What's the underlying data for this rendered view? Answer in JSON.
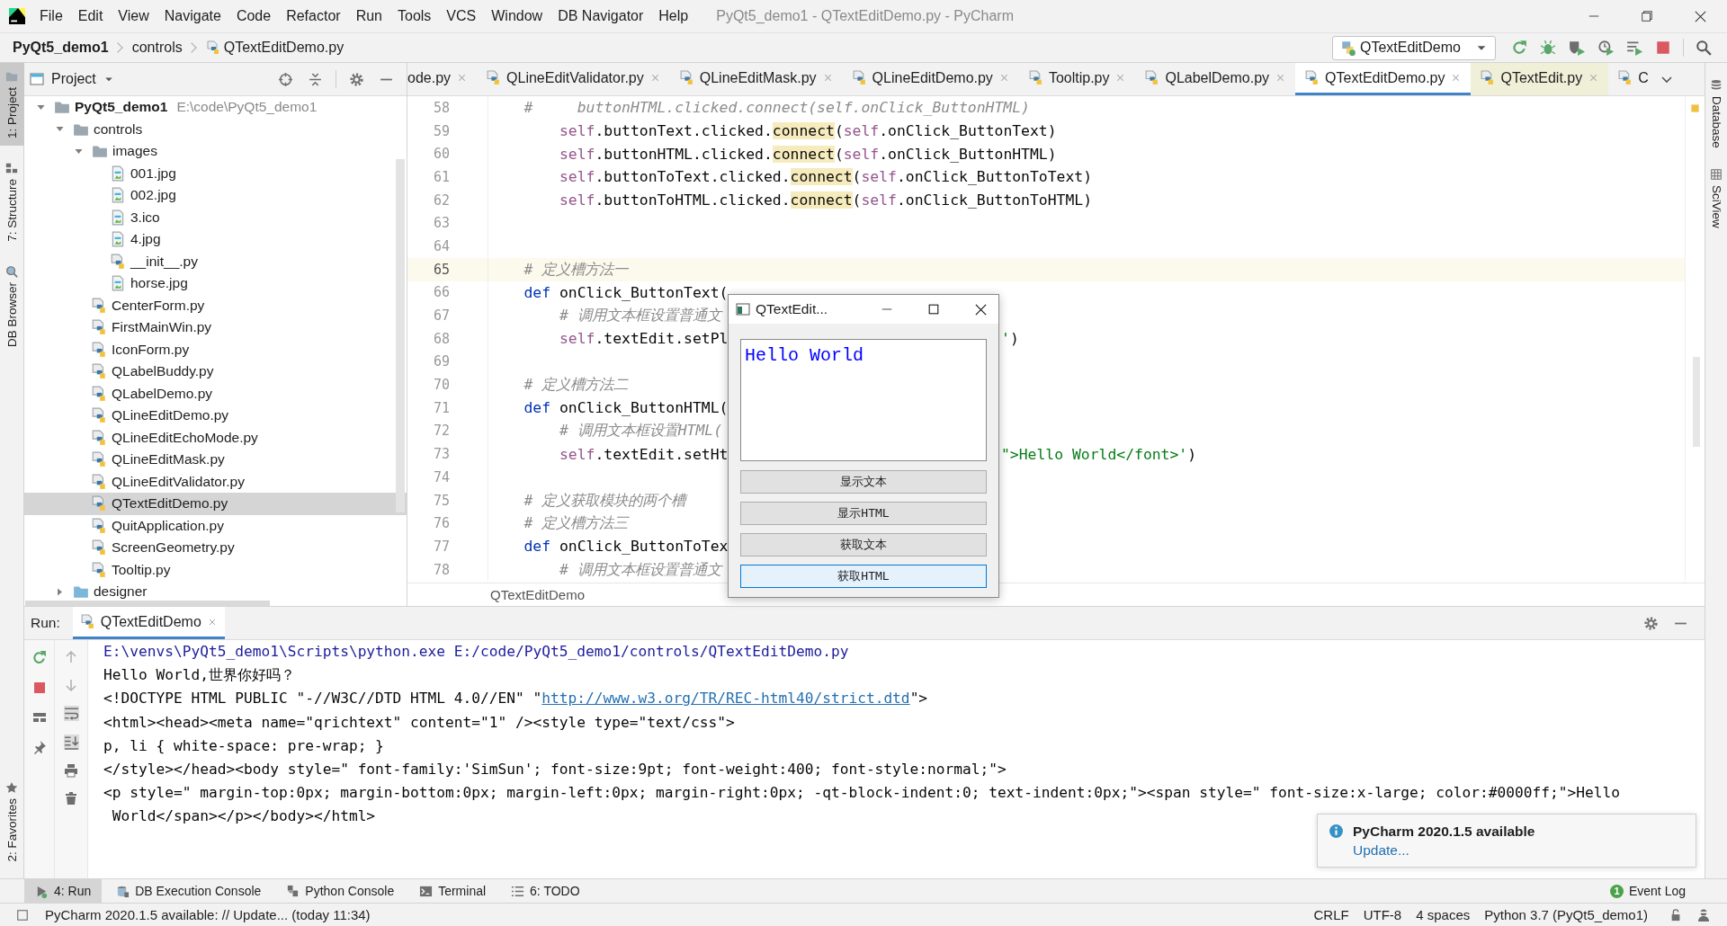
{
  "window": {
    "title": "PyQt5_demo1 - QTextEditDemo.py - PyCharm"
  },
  "menu": [
    "File",
    "Edit",
    "View",
    "Navigate",
    "Code",
    "Refactor",
    "Run",
    "Tools",
    "VCS",
    "Window",
    "DB Navigator",
    "Help"
  ],
  "nav": {
    "crumbs": [
      {
        "label": "PyQt5_demo1",
        "kind": "project"
      },
      {
        "label": "controls",
        "kind": "folder"
      },
      {
        "label": "QTextEditDemo.py",
        "kind": "file"
      }
    ],
    "run_config": "QTextEditDemo"
  },
  "left_strip": [
    {
      "label": "1: Project",
      "kind": "project",
      "selected": true
    },
    {
      "label": "7: Structure",
      "kind": "structure",
      "selected": false
    },
    {
      "label": "DB Browser",
      "kind": "db",
      "selected": false
    },
    {
      "label": "2: Favorites",
      "kind": "favorites",
      "selected": false
    }
  ],
  "right_strip": [
    {
      "label": "Database",
      "kind": "database"
    },
    {
      "label": "SciView",
      "kind": "sciview"
    }
  ],
  "project": {
    "title": "Project",
    "tree": [
      {
        "label": "PyQt5_demo1",
        "path": "E:\\code\\PyQt5_demo1",
        "kind": "folder",
        "expanded": true,
        "selected": false,
        "children": [
          {
            "label": "controls",
            "kind": "folder",
            "expanded": true,
            "selected": false,
            "children": [
              {
                "label": "images",
                "kind": "folder",
                "expanded": true,
                "selected": false,
                "children": [
                  {
                    "label": "001.jpg",
                    "kind": "image",
                    "selected": false
                  },
                  {
                    "label": "002.jpg",
                    "kind": "image",
                    "selected": false
                  },
                  {
                    "label": "3.ico",
                    "kind": "image",
                    "selected": false
                  },
                  {
                    "label": "4.jpg",
                    "kind": "image",
                    "selected": false
                  },
                  {
                    "label": "__init__.py",
                    "kind": "python",
                    "selected": false
                  },
                  {
                    "label": "horse.jpg",
                    "kind": "image",
                    "selected": false
                  }
                ]
              },
              {
                "label": "CenterForm.py",
                "kind": "python",
                "selected": false
              },
              {
                "label": "FirstMainWin.py",
                "kind": "python",
                "selected": false
              },
              {
                "label": "IconForm.py",
                "kind": "python",
                "selected": false
              },
              {
                "label": "QLabelBuddy.py",
                "kind": "python",
                "selected": false
              },
              {
                "label": "QLabelDemo.py",
                "kind": "python",
                "selected": false
              },
              {
                "label": "QLineEditDemo.py",
                "kind": "python",
                "selected": false
              },
              {
                "label": "QLineEditEchoMode.py",
                "kind": "python",
                "selected": false
              },
              {
                "label": "QLineEditMask.py",
                "kind": "python",
                "selected": false
              },
              {
                "label": "QLineEditValidator.py",
                "kind": "python",
                "selected": false
              },
              {
                "label": "QTextEditDemo.py",
                "kind": "python",
                "selected": true
              },
              {
                "label": "QuitApplication.py",
                "kind": "python",
                "selected": false
              },
              {
                "label": "ScreenGeometry.py",
                "kind": "python",
                "selected": false
              },
              {
                "label": "Tooltip.py",
                "kind": "python",
                "selected": false
              }
            ]
          },
          {
            "label": "designer",
            "kind": "folder",
            "expanded": false,
            "selected": false
          }
        ]
      }
    ]
  },
  "editor": {
    "tabs": [
      {
        "label": "ode.py",
        "kind": "project",
        "selected": false,
        "closable": true,
        "icon": false
      },
      {
        "label": "QLineEditValidator.py",
        "kind": "project",
        "selected": false,
        "closable": true,
        "icon": true
      },
      {
        "label": "QLineEditMask.py",
        "kind": "project",
        "selected": false,
        "closable": true,
        "icon": true
      },
      {
        "label": "QLineEditDemo.py",
        "kind": "project",
        "selected": false,
        "closable": true,
        "icon": true
      },
      {
        "label": "Tooltip.py",
        "kind": "project",
        "selected": false,
        "closable": true,
        "icon": true
      },
      {
        "label": "QLabelDemo.py",
        "kind": "project",
        "selected": false,
        "closable": true,
        "icon": true
      },
      {
        "label": "QTextEditDemo.py",
        "kind": "project",
        "selected": true,
        "closable": true,
        "icon": true
      },
      {
        "label": "QTextEdit.py",
        "kind": "library",
        "selected": false,
        "closable": true,
        "icon": true
      },
      {
        "label": "C",
        "kind": "project",
        "selected": false,
        "closable": false,
        "icon": true
      }
    ],
    "lines": [
      {
        "number": "58",
        "current": false,
        "tokens": [
          {
            "kind": "comment",
            "text": "    #     buttonHTML.clicked.connect(self.onClick_ButtonHTML)"
          }
        ]
      },
      {
        "number": "59",
        "current": false,
        "tokens": [
          {
            "kind": "self",
            "text": "        self"
          },
          {
            "kind": "plain",
            "text": ".buttonText.clicked."
          },
          {
            "kind": "match",
            "text": "connect"
          },
          {
            "kind": "plain",
            "text": "("
          },
          {
            "kind": "self",
            "text": "self"
          },
          {
            "kind": "plain",
            "text": ".onClick_ButtonText)"
          }
        ]
      },
      {
        "number": "60",
        "current": false,
        "tokens": [
          {
            "kind": "self",
            "text": "        self"
          },
          {
            "kind": "plain",
            "text": ".buttonHTML.clicked."
          },
          {
            "kind": "match",
            "text": "connect"
          },
          {
            "kind": "plain",
            "text": "("
          },
          {
            "kind": "self",
            "text": "self"
          },
          {
            "kind": "plain",
            "text": ".onClick_ButtonHTML)"
          }
        ]
      },
      {
        "number": "61",
        "current": false,
        "tokens": [
          {
            "kind": "self",
            "text": "        self"
          },
          {
            "kind": "plain",
            "text": ".buttonToText.clicked."
          },
          {
            "kind": "match",
            "text": "connect"
          },
          {
            "kind": "plain",
            "text": "("
          },
          {
            "kind": "self",
            "text": "self"
          },
          {
            "kind": "plain",
            "text": ".onClick_ButtonToText)"
          }
        ]
      },
      {
        "number": "62",
        "current": false,
        "tokens": [
          {
            "kind": "self",
            "text": "        self"
          },
          {
            "kind": "plain",
            "text": ".buttonToHTML.clicked."
          },
          {
            "kind": "match",
            "text": "connect"
          },
          {
            "kind": "plain",
            "text": "("
          },
          {
            "kind": "self",
            "text": "self"
          },
          {
            "kind": "plain",
            "text": ".onClick_ButtonToHTML)"
          }
        ]
      },
      {
        "number": "63",
        "current": false
      },
      {
        "number": "64",
        "current": false
      },
      {
        "number": "65",
        "current": true,
        "tokens": [
          {
            "kind": "comment",
            "text": "    # 定义槽方法一"
          }
        ]
      },
      {
        "number": "66",
        "current": false,
        "tokens": [
          {
            "kind": "kw",
            "text": "    def"
          },
          {
            "kind": "plain",
            "text": " onClick_ButtonText("
          }
        ]
      },
      {
        "number": "67",
        "current": false,
        "tokens": [
          {
            "kind": "comment",
            "text": "        # 调用文本框设置普通文"
          }
        ]
      },
      {
        "number": "68",
        "current": false,
        "tokens": [
          {
            "kind": "self",
            "text": "        self"
          },
          {
            "kind": "plain",
            "text": ".textEdit.setPl"
          }
        ],
        "tail": [
          {
            "kind": "str",
            "text": "'"
          },
          {
            "kind": "plain",
            "text": ")"
          }
        ]
      },
      {
        "number": "69",
        "current": false
      },
      {
        "number": "70",
        "current": false,
        "tokens": [
          {
            "kind": "comment",
            "text": "    # 定义槽方法二"
          }
        ]
      },
      {
        "number": "71",
        "current": false,
        "tokens": [
          {
            "kind": "kw",
            "text": "    def"
          },
          {
            "kind": "plain",
            "text": " onClick_ButtonHTML("
          }
        ]
      },
      {
        "number": "72",
        "current": false,
        "tokens": [
          {
            "kind": "comment",
            "text": "        # 调用文本框设置HTML("
          }
        ]
      },
      {
        "number": "73",
        "current": false,
        "tokens": [
          {
            "kind": "self",
            "text": "        self"
          },
          {
            "kind": "plain",
            "text": ".textEdit.setHt"
          }
        ],
        "tail": [
          {
            "kind": "str",
            "text": "\">Hello World</font>'"
          },
          {
            "kind": "plain",
            "text": ")"
          }
        ]
      },
      {
        "number": "74",
        "current": false
      },
      {
        "number": "75",
        "current": false,
        "tokens": [
          {
            "kind": "comment",
            "text": "    # 定义获取模块的两个槽"
          }
        ]
      },
      {
        "number": "76",
        "current": false,
        "tokens": [
          {
            "kind": "comment",
            "text": "    # 定义槽方法三"
          }
        ]
      },
      {
        "number": "77",
        "current": false,
        "tokens": [
          {
            "kind": "kw",
            "text": "    def"
          },
          {
            "kind": "plain",
            "text": " onClick_ButtonToTex"
          }
        ]
      },
      {
        "number": "78",
        "current": false,
        "tokens": [
          {
            "kind": "comment",
            "text": "        # 调用文本框设置普通文"
          }
        ]
      }
    ],
    "breadcrumb": "QTextEditDemo"
  },
  "dialog": {
    "title": "QTextEdit...",
    "text": "Hello World",
    "buttons": [
      {
        "label": "显示文本",
        "focused": false
      },
      {
        "label": "显示HTML",
        "focused": false
      },
      {
        "label": "获取文本",
        "focused": false
      },
      {
        "label": "获取HTML",
        "focused": true
      }
    ]
  },
  "run": {
    "label": "Run:",
    "tab": "QTextEditDemo",
    "output": [
      [
        {
          "kind": "command",
          "text": "E:\\venvs\\PyQt5_demo1\\Scripts\\python.exe E:/code/PyQt5_demo1/controls/QTextEditDemo.py"
        }
      ],
      [
        {
          "kind": "text",
          "text": "Hello World,世界你好吗？"
        }
      ],
      [
        {
          "kind": "text",
          "text": "<!DOCTYPE HTML PUBLIC \"-//W3C//DTD HTML 4.0//EN\" \""
        },
        {
          "kind": "link",
          "text": "http://www.w3.org/TR/REC-html40/strict.dtd"
        },
        {
          "kind": "text",
          "text": "\">"
        }
      ],
      [
        {
          "kind": "text",
          "text": "<html><head><meta name=\"qrichtext\" content=\"1\" /><style type=\"text/css\">"
        }
      ],
      [
        {
          "kind": "text",
          "text": "p, li { white-space: pre-wrap; }"
        }
      ],
      [
        {
          "kind": "text",
          "text": "</style></head><body style=\" font-family:'SimSun'; font-size:9pt; font-weight:400; font-style:normal;\">"
        }
      ],
      [
        {
          "kind": "text",
          "text": "<p style=\" margin-top:0px; margin-bottom:0px; margin-left:0px; margin-right:0px; -qt-block-indent:0; text-indent:0px;\"><span style=\" font-size:x-large; color:#0000ff;\">Hello"
        }
      ],
      [
        {
          "kind": "text",
          "text": " World</span></p></body></html>"
        }
      ]
    ]
  },
  "notification": {
    "title": "PyCharm 2020.1.5 available",
    "link": "Update..."
  },
  "tool_windows": [
    {
      "label": "4: Run",
      "kind": "run",
      "selected": true
    },
    {
      "label": "DB Execution Console",
      "kind": "db",
      "selected": false
    },
    {
      "label": "Python Console",
      "kind": "python",
      "selected": false
    },
    {
      "label": "Terminal",
      "kind": "terminal",
      "selected": false
    },
    {
      "label": "6: TODO",
      "kind": "todo",
      "selected": false
    }
  ],
  "event_log": {
    "label": "Event Log",
    "count": "1"
  },
  "status_bar": {
    "message": "PyCharm 2020.1.5 available: // Update... (today 11:34)",
    "items": [
      "CRLF",
      "UTF-8",
      "4 spaces",
      "Python 3.7 (PyQt5_demo1)"
    ]
  }
}
